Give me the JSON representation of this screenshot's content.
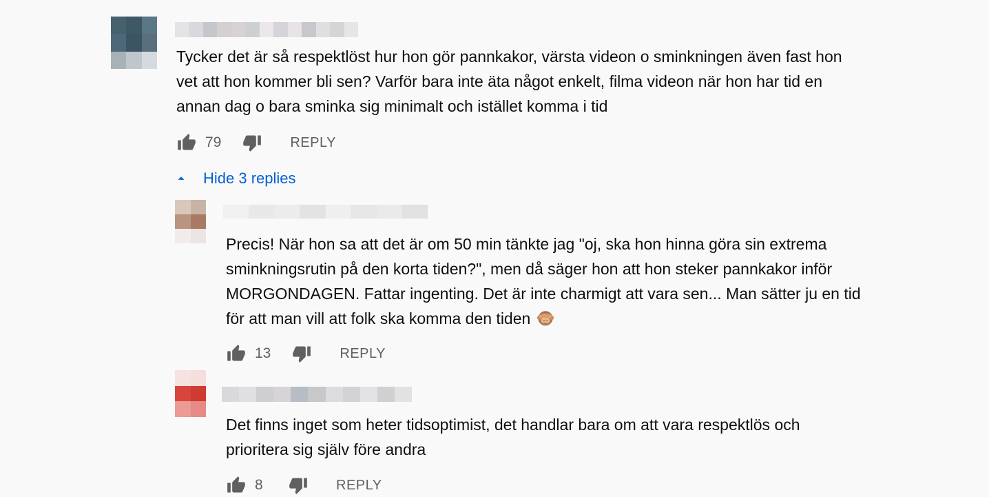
{
  "comment": {
    "text": "Tycker det är så respektlöst hur hon gör pannkakor, värsta videon o sminkningen även fast hon\nvet att hon kommer bli sen? Varför bara inte äta något enkelt, filma videon när hon har tid en\nannan dag o bara sminka sig minimalt och istället komma i tid",
    "likes": "79",
    "reply_label": "REPLY",
    "avatar_colors": [
      "#46606d",
      "#3e5866",
      "#5a7785",
      "#4d6978",
      "#3c5565",
      "#59707c",
      "#a7b2b8",
      "#bfc7cc",
      "#d5dade"
    ],
    "author_colors": [
      "#e4e4e6",
      "#d9d8dc",
      "#c4c8cc",
      "#d4d0d0",
      "#d8d2d4",
      "#ccd0d2",
      "#ebe7eb",
      "#d6d4d8",
      "#e7e3e7",
      "#c9c7cb",
      "#dfdfe1",
      "#d3d5d7",
      "#e6e6e8"
    ]
  },
  "replies_toggle": {
    "label": "Hide 3 replies"
  },
  "replies": [
    {
      "text_before_emoji": "Precis! När hon sa att det är om 50 min tänkte jag \"oj, ska hon hinna göra sin extrema\nsminkningsrutin på den korta tiden?\", men då säger hon att hon steker pannkakor inför\nMORGONDAGEN. Fattar ingenting. Det är inte charmigt att vara sen... Man sätter ju en tid\nför att man vill att folk ska komma den tiden ",
      "emoji_icon": "see-no-evil-monkey-icon",
      "likes": "13",
      "reply_label": "REPLY",
      "avatar_colors": [
        "#d8c8bc",
        "#c9b3a6",
        "#b99480",
        "#a87a64",
        "#f1ecea",
        "#eae4e2"
      ],
      "author_colors": [
        "#f0f0f0",
        "#e8e8e8",
        "#ececec",
        "#e3e3e3",
        "#efefef",
        "#e6e6e6",
        "#eaeaea",
        "#e1e1e1"
      ]
    },
    {
      "text": "Det finns inget som heter tidsoptimist, det handlar bara om att vara respektlös och\nprioritera sig själv före andra",
      "likes": "8",
      "reply_label": "REPLY",
      "avatar_colors": [
        "#f6e3e1",
        "#f5dedc",
        "#d8453c",
        "#cf3a31",
        "#eb9a94",
        "#e78984"
      ],
      "author_colors": [
        "#d9d9db",
        "#e0dfe1",
        "#cfcfd2",
        "#d6d4d6",
        "#b8bcc4",
        "#c8c8ca",
        "#dcdcde",
        "#d2d2d4",
        "#e3e3e5",
        "#d0d0d2",
        "#e2e2e2"
      ]
    }
  ]
}
